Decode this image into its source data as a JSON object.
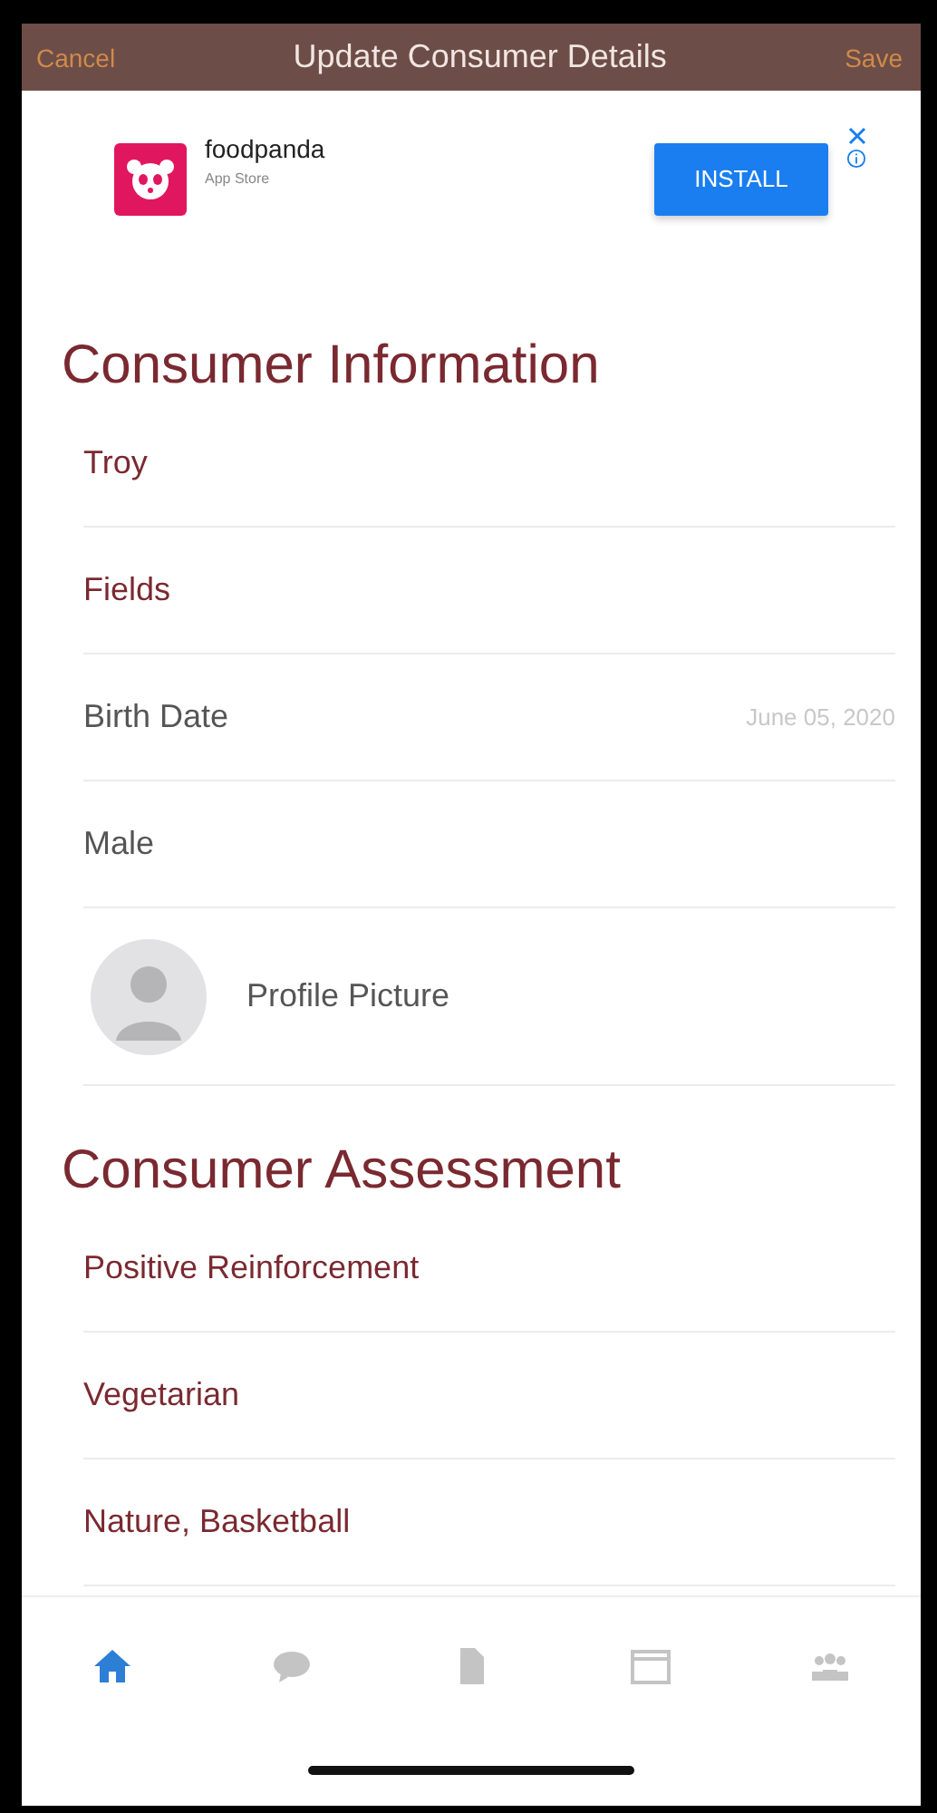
{
  "nav": {
    "cancel": "Cancel",
    "title": "Update Consumer Details",
    "save": "Save"
  },
  "ad": {
    "app_name": "foodpanda",
    "store": "App Store",
    "button": "INSTALL"
  },
  "sections": [
    {
      "title": "Consumer Information",
      "rows": [
        {
          "kind": "value",
          "text": "Troy"
        },
        {
          "kind": "value",
          "text": "Fields"
        },
        {
          "kind": "date",
          "label": "Birth Date",
          "value": "June 05, 2020"
        },
        {
          "kind": "plain",
          "text": "Male"
        },
        {
          "kind": "avatar",
          "text": "Profile Picture"
        }
      ]
    },
    {
      "title": "Consumer Assessment",
      "rows": [
        {
          "kind": "value",
          "text": "Positive Reinforcement"
        },
        {
          "kind": "value",
          "text": "Vegetarian"
        },
        {
          "kind": "value",
          "text": "Nature, Basketball"
        }
      ]
    }
  ],
  "tabs": [
    {
      "kind": "home",
      "selected": true
    },
    {
      "kind": "chat",
      "selected": false
    },
    {
      "kind": "document",
      "selected": false
    },
    {
      "kind": "calendar",
      "selected": false
    },
    {
      "kind": "people",
      "selected": false
    }
  ]
}
